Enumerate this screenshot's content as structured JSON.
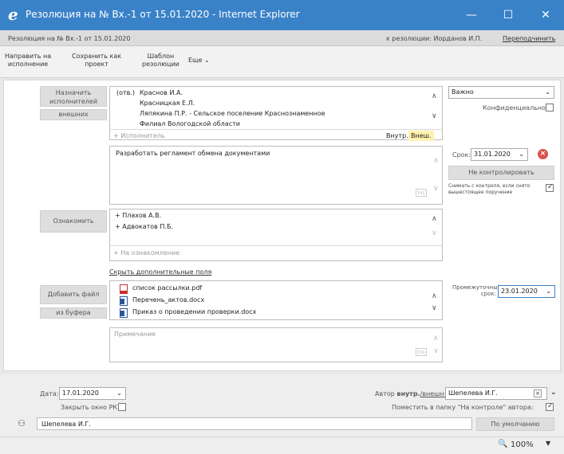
{
  "window": {
    "title": "Резолюция на № Вх.-1 от 15.01.2020 - Internet Explorer",
    "min": "—",
    "max": "☐",
    "close": "✕"
  },
  "header": {
    "left": "Резолюция на № Вх.-1 от 15.01.2020",
    "right": "к резолюции: Иорданов И.П.",
    "link": "Переподчинить"
  },
  "toolbar": {
    "send": [
      "Направить на",
      "исполнение"
    ],
    "save": [
      "Сохранить как",
      "проект"
    ],
    "template": [
      "Шаблон",
      "резолюции"
    ],
    "more": "Еще ⌄"
  },
  "executors": {
    "assign_btn": [
      "Назначить",
      "исполнителей"
    ],
    "external_btn": "внешних",
    "items": [
      {
        "prefix": "(отв.)",
        "name": "Краснов И.А."
      },
      {
        "prefix": "",
        "name": "Красницкая Е.Л."
      },
      {
        "prefix": "",
        "name": "Ляпякина П.Р. - Сельское поселение Краснознаменное"
      },
      {
        "prefix": "",
        "name": "Филиал Вологодской области"
      }
    ],
    "add_placeholder": "+ Исполнитель",
    "tab_internal": "Внутр.",
    "tab_external": "Внеш."
  },
  "priority": {
    "value": "Важно",
    "confidential_label": "Конфиденциально:"
  },
  "task": {
    "text": "Разработать регламент обмена документами",
    "deadline_label": "Срок:",
    "deadline": "31.01.2020",
    "no_control_btn": "Не контролировать",
    "remove_control": "Снимать с контроля, если снято вышестоящее поручение"
  },
  "acquaint": {
    "btn": "Ознакомить",
    "items": [
      "+ Плахов А.В.",
      "+ Адвокатов П.Б."
    ],
    "placeholder": "+ На ознакомление"
  },
  "hide_fields_link": "Скрыть дополнительные поля",
  "files": {
    "add_btn": "Добавить файл",
    "buffer_btn": "из буфера",
    "items": [
      {
        "icon": "pdf-icon",
        "name": "список рассылки.pdf"
      },
      {
        "icon": "word-icon",
        "name": "Перечень_актов.docx"
      },
      {
        "icon": "word-icon",
        "name": "Приказ о проведении проверки.docx"
      }
    ],
    "interim_label": "Промежуточный срок:",
    "interim_date": "23.01.2020"
  },
  "note": {
    "placeholder": "Примечание"
  },
  "footer": {
    "date_label": "Дата:",
    "date": "17.01.2020",
    "close_window_label": "Закрыть окно РК:",
    "author_label_pre": "Автор ",
    "author_label_bold": "внутр.",
    "author_label_post": "/внешн:",
    "author": "Шепелева И.Г.",
    "put_folder_label": "Поместить в папку \"На контроле\" автора:",
    "signer": "Шепелева И.Г.",
    "default_btn": "По умолчанию"
  },
  "status": {
    "zoom": "100%"
  }
}
